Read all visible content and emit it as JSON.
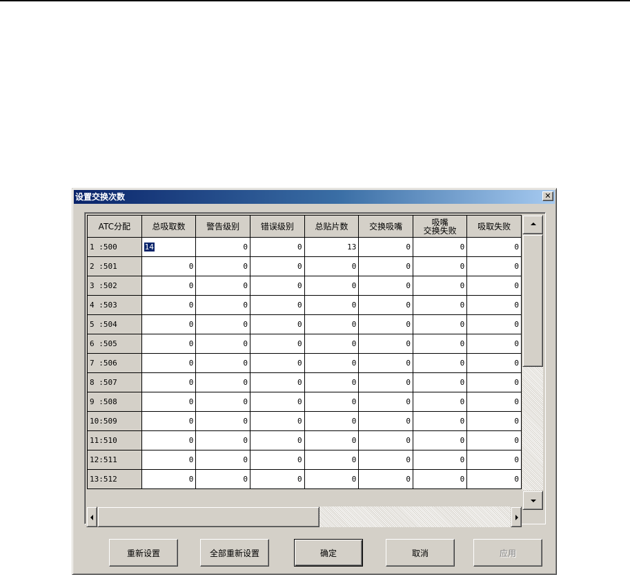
{
  "dialog": {
    "title": "设置交换次数",
    "close_glyph": "✕"
  },
  "table": {
    "headers": [
      "ATC分配",
      "总吸取数",
      "警告级别",
      "错误级别",
      "总贴片数",
      "交换吸嘴",
      "吸嘴\n交换失败",
      "吸取失败"
    ],
    "rows": [
      {
        "label": "1 :500",
        "values": [
          "14",
          "0",
          "0",
          "13",
          "0",
          "0",
          "0"
        ]
      },
      {
        "label": "2 :501",
        "values": [
          "0",
          "0",
          "0",
          "0",
          "0",
          "0",
          "0"
        ]
      },
      {
        "label": "3 :502",
        "values": [
          "0",
          "0",
          "0",
          "0",
          "0",
          "0",
          "0"
        ]
      },
      {
        "label": "4 :503",
        "values": [
          "0",
          "0",
          "0",
          "0",
          "0",
          "0",
          "0"
        ]
      },
      {
        "label": "5 :504",
        "values": [
          "0",
          "0",
          "0",
          "0",
          "0",
          "0",
          "0"
        ]
      },
      {
        "label": "6 :505",
        "values": [
          "0",
          "0",
          "0",
          "0",
          "0",
          "0",
          "0"
        ]
      },
      {
        "label": "7 :506",
        "values": [
          "0",
          "0",
          "0",
          "0",
          "0",
          "0",
          "0"
        ]
      },
      {
        "label": "8 :507",
        "values": [
          "0",
          "0",
          "0",
          "0",
          "0",
          "0",
          "0"
        ]
      },
      {
        "label": "9 :508",
        "values": [
          "0",
          "0",
          "0",
          "0",
          "0",
          "0",
          "0"
        ]
      },
      {
        "label": "10:509",
        "values": [
          "0",
          "0",
          "0",
          "0",
          "0",
          "0",
          "0"
        ]
      },
      {
        "label": "11:510",
        "values": [
          "0",
          "0",
          "0",
          "0",
          "0",
          "0",
          "0"
        ]
      },
      {
        "label": "12:511",
        "values": [
          "0",
          "0",
          "0",
          "0",
          "0",
          "0",
          "0"
        ]
      },
      {
        "label": "13:512",
        "values": [
          "0",
          "0",
          "0",
          "0",
          "0",
          "0",
          "0"
        ]
      }
    ]
  },
  "buttons": {
    "reset": "重新设置",
    "reset_all": "全部重新设置",
    "ok": "确定",
    "cancel": "取消",
    "apply": "应用"
  }
}
